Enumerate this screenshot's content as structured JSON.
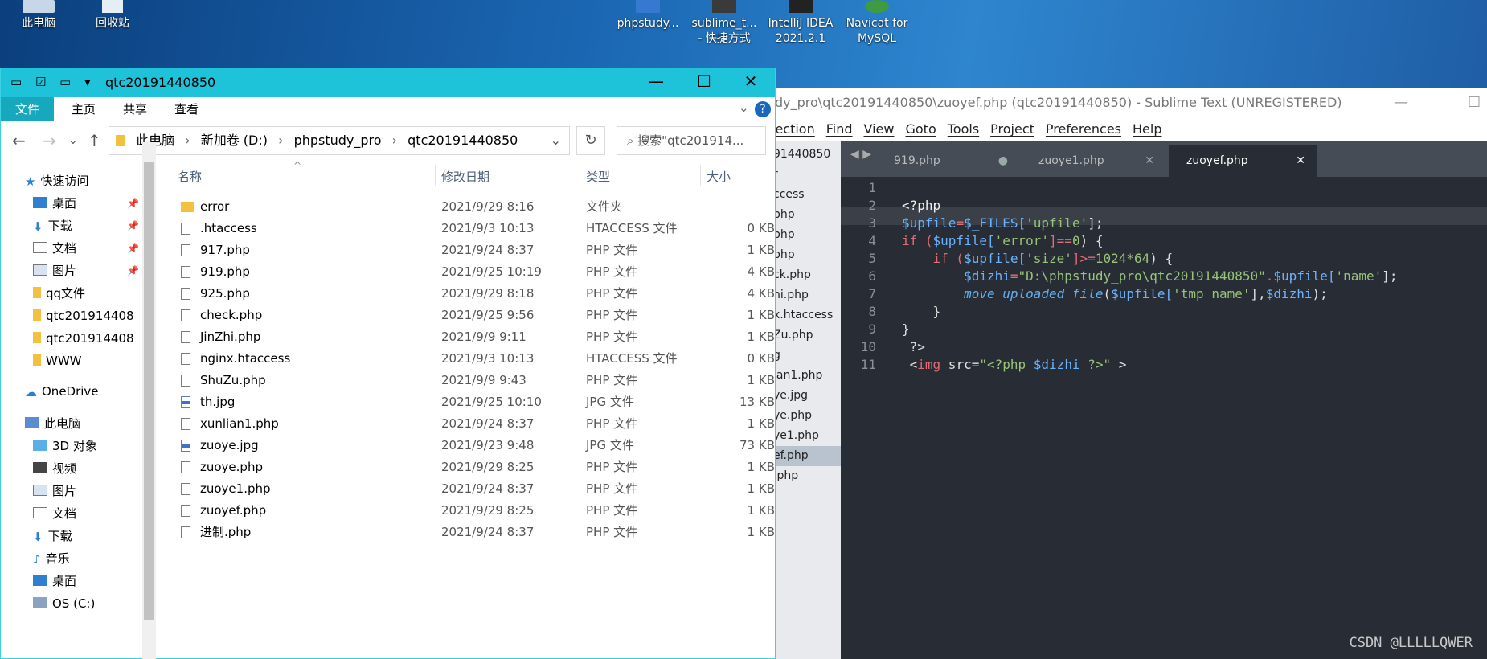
{
  "desktop": {
    "icons": [
      {
        "label": "此电脑"
      },
      {
        "label": "回收站"
      },
      {
        "label": "phpstudy..."
      },
      {
        "label": "sublime_t...",
        "label2": "- 快捷方式"
      },
      {
        "label": "IntelliJ IDEA",
        "label2": "2021.2.1"
      },
      {
        "label": "Navicat for",
        "label2": "MySQL"
      }
    ]
  },
  "sublime": {
    "title": "dy_pro\\qtc20191440850\\zuoyef.php (qtc20191440850) - Sublime Text (UNREGISTERED)",
    "menu": [
      "lection",
      "Find",
      "View",
      "Goto",
      "Tools",
      "Project",
      "Preferences",
      "Help"
    ],
    "sidebar": [
      "91440850",
      "r",
      "ccess",
      "php",
      "php",
      "php",
      "ck.php",
      "hi.php",
      "x.htaccess",
      "Zu.php",
      "g",
      "ian1.php",
      "ye.jpg",
      "ye.php",
      "ye1.php",
      "ef.php",
      ".php"
    ],
    "tabs": [
      {
        "label": "919.php",
        "x": "●"
      },
      {
        "label": "zuoye1.php",
        "x": "✕"
      },
      {
        "label": "zuoyef.php",
        "x": "✕"
      }
    ],
    "line_numbers": [
      "1",
      "2",
      "3",
      "4",
      "5",
      "6",
      "7",
      "8",
      "9",
      "10",
      "11"
    ],
    "code": {
      "l2": "<?php",
      "l3a": "$upfile",
      "l3b": "=",
      "l3c": "$_FILES[",
      "l3d": "'upfile'",
      "l3e": "];",
      "l4a": "if (",
      "l4b": "$upfile[",
      "l4c": "'error'",
      "l4d": "]==",
      "l4e": "0",
      "l4f": ") {",
      "l5a": "    if (",
      "l5b": "$upfile[",
      "l5c": "'size'",
      "l5d": "]>=",
      "l5e": "1024*64",
      "l5f": ") {",
      "l6a": "        $dizhi",
      "l6b": "=",
      "l6c": "\"D:\\phpstudy_pro\\qtc20191440850\"",
      "l6d": ".",
      "l6e": "$upfile[",
      "l6f": "'name'",
      "l6g": "];",
      "l7a": "        move_uploaded_file",
      "l7b": "(",
      "l7c": "$upfile[",
      "l7d": "'tmp_name'",
      "l7e": "],",
      "l7f": "$dizhi",
      "l7g": ");",
      "l8": "    }",
      "l9": "}",
      "l10": " ?>",
      "l11a": " <",
      "l11b": "img",
      "l11c": " src=",
      "l11d": "\"<?php ",
      "l11e": "$dizhi",
      "l11f": " ?>\"",
      "l11g": " >"
    },
    "watermark": "CSDN @LLLLLQWER"
  },
  "explorer": {
    "title": "qtc20191440850",
    "quick_access": "▾",
    "ribbon": [
      "文件",
      "主页",
      "共享",
      "查看"
    ],
    "address": [
      "此电脑",
      "新加卷 (D:)",
      "phpstudy_pro",
      "qtc20191440850"
    ],
    "search_placeholder": "搜索\"qtc201914...",
    "nav": {
      "quick_access": "快速访问",
      "items": [
        {
          "label": "桌面",
          "pinned": true
        },
        {
          "label": "下载",
          "pinned": true
        },
        {
          "label": "文档",
          "pinned": true
        },
        {
          "label": "图片",
          "pinned": true
        },
        {
          "label": "qq文件",
          "pinned": false
        },
        {
          "label": "qtc201914408",
          "pinned": false
        },
        {
          "label": "qtc201914408",
          "pinned": false
        },
        {
          "label": "WWW",
          "pinned": false
        }
      ],
      "onedrive": "OneDrive",
      "this_pc": "此电脑",
      "pc_items": [
        "3D 对象",
        "视频",
        "图片",
        "文档",
        "下载",
        "音乐",
        "桌面",
        "OS (C:)"
      ]
    },
    "columns": {
      "name": "名称",
      "date": "修改日期",
      "type": "类型",
      "size": "大小"
    },
    "files": [
      {
        "name": "error",
        "date": "2021/9/29 8:16",
        "type": "文件夹",
        "size": "",
        "kind": "folder"
      },
      {
        "name": ".htaccess",
        "date": "2021/9/3 10:13",
        "type": "HTACCESS 文件",
        "size": "0 KB",
        "kind": "file"
      },
      {
        "name": "917.php",
        "date": "2021/9/24 8:37",
        "type": "PHP 文件",
        "size": "1 KB",
        "kind": "file"
      },
      {
        "name": "919.php",
        "date": "2021/9/25 10:19",
        "type": "PHP 文件",
        "size": "4 KB",
        "kind": "file"
      },
      {
        "name": "925.php",
        "date": "2021/9/29 8:18",
        "type": "PHP 文件",
        "size": "4 KB",
        "kind": "file"
      },
      {
        "name": "check.php",
        "date": "2021/9/25 9:56",
        "type": "PHP 文件",
        "size": "1 KB",
        "kind": "file"
      },
      {
        "name": "JinZhi.php",
        "date": "2021/9/9 9:11",
        "type": "PHP 文件",
        "size": "1 KB",
        "kind": "file"
      },
      {
        "name": "nginx.htaccess",
        "date": "2021/9/3 10:13",
        "type": "HTACCESS 文件",
        "size": "0 KB",
        "kind": "file"
      },
      {
        "name": "ShuZu.php",
        "date": "2021/9/9 9:43",
        "type": "PHP 文件",
        "size": "1 KB",
        "kind": "file"
      },
      {
        "name": "th.jpg",
        "date": "2021/9/25 10:10",
        "type": "JPG 文件",
        "size": "13 KB",
        "kind": "jpg"
      },
      {
        "name": "xunlian1.php",
        "date": "2021/9/24 8:37",
        "type": "PHP 文件",
        "size": "1 KB",
        "kind": "file"
      },
      {
        "name": "zuoye.jpg",
        "date": "2021/9/23 9:48",
        "type": "JPG 文件",
        "size": "73 KB",
        "kind": "jpg"
      },
      {
        "name": "zuoye.php",
        "date": "2021/9/29 8:25",
        "type": "PHP 文件",
        "size": "1 KB",
        "kind": "file"
      },
      {
        "name": "zuoye1.php",
        "date": "2021/9/24 8:37",
        "type": "PHP 文件",
        "size": "1 KB",
        "kind": "file"
      },
      {
        "name": "zuoyef.php",
        "date": "2021/9/29 8:25",
        "type": "PHP 文件",
        "size": "1 KB",
        "kind": "file"
      },
      {
        "name": "进制.php",
        "date": "2021/9/24 8:37",
        "type": "PHP 文件",
        "size": "1 KB",
        "kind": "file"
      }
    ]
  }
}
